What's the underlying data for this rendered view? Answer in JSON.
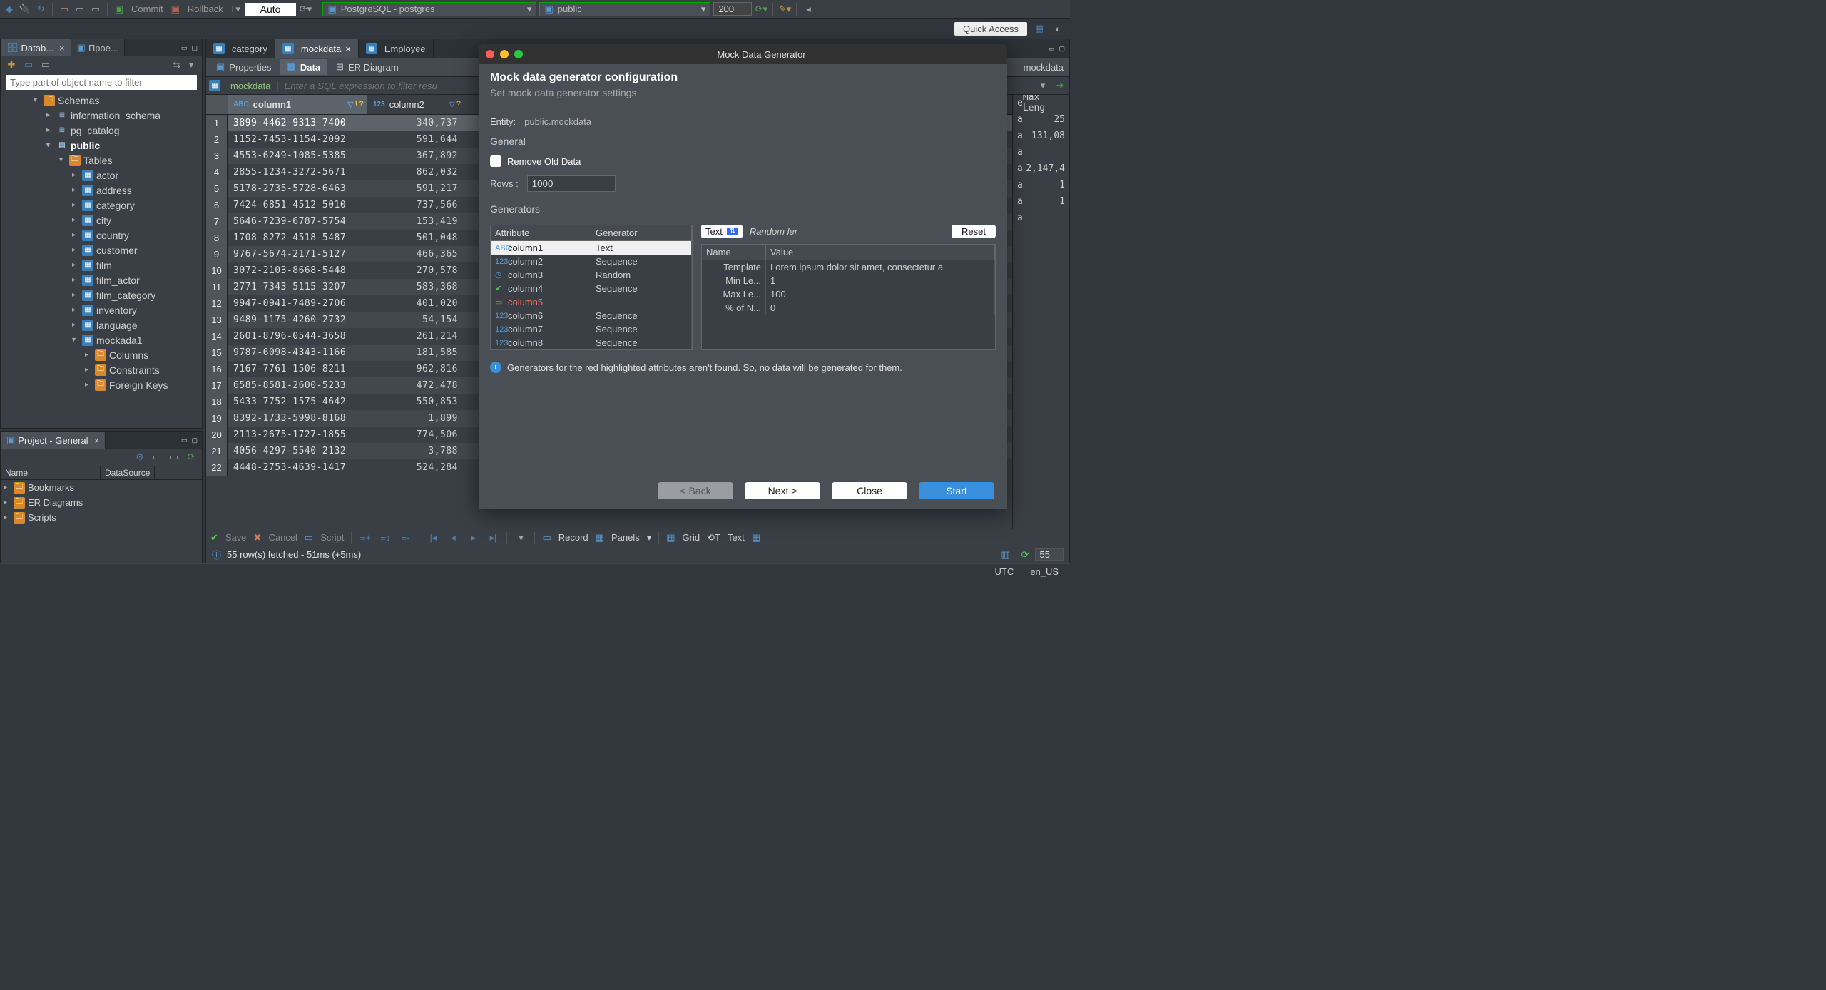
{
  "top": {
    "commit": "Commit",
    "rollback": "Rollback",
    "auto": "Auto",
    "connection": "PostgreSQL - postgres",
    "schema": "public",
    "limit": "200",
    "quick_access": "Quick Access"
  },
  "dbnav": {
    "tab1": "Datab...",
    "tab2": "Прое...",
    "filter_placeholder": "Type part of object name to filter",
    "schemas": "Schemas",
    "info_schema": "information_schema",
    "pg_catalog": "pg_catalog",
    "public": "public",
    "tables": "Tables",
    "items": [
      "actor",
      "address",
      "category",
      "city",
      "country",
      "customer",
      "film",
      "film_actor",
      "film_category",
      "inventory",
      "language",
      "mockada1"
    ],
    "sub_items": [
      "Columns",
      "Constraints",
      "Foreign Keys"
    ]
  },
  "project": {
    "title": "Project - General",
    "name_col": "Name",
    "ds_col": "DataSource",
    "items": [
      "Bookmarks",
      "ER Diagrams",
      "Scripts"
    ]
  },
  "editor": {
    "tabs": [
      "category",
      "mockdata",
      "Employee"
    ],
    "sidebar_label": "mockdata",
    "sub_tabs": {
      "properties": "Properties",
      "data": "Data",
      "er": "ER Diagram"
    },
    "filter_name": "mockdata",
    "filter_hint": "Enter a SQL expression to filter resu",
    "columns": [
      "column1",
      "column2"
    ],
    "rows": [
      [
        "3899-4462-9313-7400",
        "340,737"
      ],
      [
        "1152-7453-1154-2092",
        "591,644"
      ],
      [
        "4553-6249-1085-5385",
        "367,892"
      ],
      [
        "2855-1234-3272-5671",
        "862,032"
      ],
      [
        "5178-2735-5728-6463",
        "591,217"
      ],
      [
        "7424-6851-4512-5010",
        "737,566"
      ],
      [
        "5646-7239-6787-5754",
        "153,419"
      ],
      [
        "1708-8272-4518-5487",
        "501,048"
      ],
      [
        "9767-5674-2171-5127",
        "466,365"
      ],
      [
        "3072-2103-8668-5448",
        "270,578"
      ],
      [
        "2771-7343-5115-3207",
        "583,368"
      ],
      [
        "9947-0941-7489-2706",
        "401,020"
      ],
      [
        "9489-1175-4260-2732",
        "54,154"
      ],
      [
        "2601-8796-0544-3658",
        "261,214"
      ],
      [
        "9787-6098-4343-1166",
        "181,585"
      ],
      [
        "7167-7761-1506-8211",
        "962,816"
      ],
      [
        "6585-8581-2600-5233",
        "472,478"
      ],
      [
        "5433-7752-1575-4642",
        "550,853"
      ],
      [
        "8392-1733-5998-8168",
        "1,899"
      ],
      [
        "2113-2675-1727-1855",
        "774,506"
      ],
      [
        "4056-4297-5540-2132",
        "3,788"
      ],
      [
        "4448-2753-4639-1417",
        "524,284"
      ]
    ],
    "right_head1": "e",
    "right_head2": "Max Leng",
    "right_vals": [
      "a|25",
      "a|131,08",
      "a|",
      "a|2,147,4",
      "a|1",
      "a|1",
      "a|"
    ],
    "bottom": {
      "save": "Save",
      "cancel": "Cancel",
      "script": "Script",
      "record": "Record",
      "panels": "Panels",
      "grid": "Grid",
      "text": "Text"
    },
    "status_msg": "55 row(s) fetched - 51ms (+5ms)",
    "status_count": "55"
  },
  "dialog": {
    "title_bar": "Mock Data Generator",
    "title": "Mock data generator configuration",
    "subtitle": "Set mock data generator settings",
    "entity_label": "Entity:",
    "entity": "public.mockdata",
    "general": "General",
    "remove_old": "Remove Old Data",
    "rows_label": "Rows :",
    "rows_value": "1000",
    "generators": "Generators",
    "tbl_head": [
      "Attribute",
      "Generator"
    ],
    "attrs": [
      {
        "name": "column1",
        "type": "abc",
        "gen": "Text"
      },
      {
        "name": "column2",
        "type": "123",
        "gen": "Sequence"
      },
      {
        "name": "column3",
        "type": "clock",
        "gen": "Random"
      },
      {
        "name": "column4",
        "type": "check",
        "gen": "Sequence"
      },
      {
        "name": "column5",
        "type": "red",
        "gen": ""
      },
      {
        "name": "column6",
        "type": "123",
        "gen": "Sequence"
      },
      {
        "name": "column7",
        "type": "123",
        "gen": "Sequence"
      },
      {
        "name": "column8",
        "type": "123",
        "gen": "Sequence"
      }
    ],
    "sel_generator": "Text",
    "random_lbl": "Random ler",
    "reset": "Reset",
    "props_head": [
      "Name",
      "Value"
    ],
    "props": [
      [
        "Template",
        "Lorem ipsum dolor sit amet, consectetur a"
      ],
      [
        "Min Le...",
        "1"
      ],
      [
        "Max Le...",
        "100"
      ],
      [
        "% of N...",
        "0"
      ]
    ],
    "info": "Generators for the red highlighted attributes aren't found. So, no data will be generated for them.",
    "buttons": {
      "back": "< Back",
      "next": "Next >",
      "close": "Close",
      "start": "Start"
    }
  },
  "footer": {
    "utc": "UTC",
    "locale": "en_US"
  }
}
